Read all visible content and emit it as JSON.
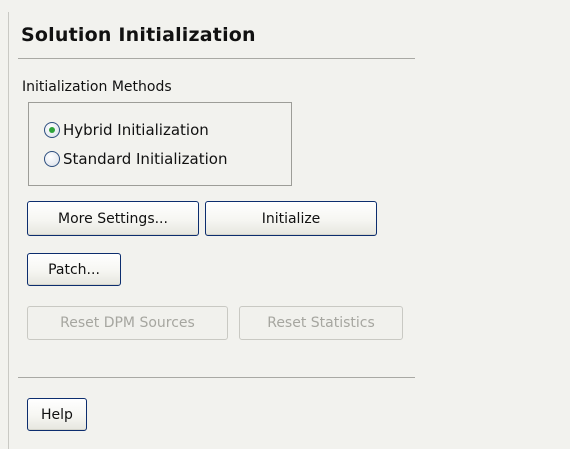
{
  "panel": {
    "title": "Solution Initialization"
  },
  "methods": {
    "label": "Initialization Methods",
    "options": [
      {
        "label": "Hybrid  Initialization",
        "selected": true
      },
      {
        "label": "Standard Initialization",
        "selected": false
      }
    ]
  },
  "buttons": {
    "more_settings": "More Settings...",
    "initialize": "Initialize",
    "patch": "Patch...",
    "reset_dpm_sources": "Reset DPM Sources",
    "reset_statistics": "Reset Statistics",
    "help": "Help"
  },
  "colors": {
    "background": "#f2f2ee",
    "button_border": "#0c2d6e",
    "radio_selected_dot": "#2ea43a",
    "disabled_text": "#a6a6a0"
  },
  "icons": {
    "radio_selected": "radio-selected-icon",
    "radio_unselected": "radio-unselected-icon"
  }
}
